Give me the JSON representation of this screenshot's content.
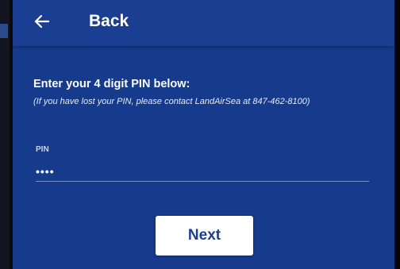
{
  "header": {
    "back_label": "Back",
    "back_icon": "left-arrow-icon"
  },
  "form": {
    "prompt": "Enter your 4 digit PIN below:",
    "help_text": "(If you have lost your PIN, please contact LandAirSea at 847-462-8100)",
    "pin_label": "PIN",
    "pin_value": "••••"
  },
  "actions": {
    "next_label": "Next"
  },
  "colors": {
    "background": "#163a8c",
    "header": "#1a3e92",
    "button_bg": "#ffffff",
    "button_text": "#1a3e92"
  }
}
